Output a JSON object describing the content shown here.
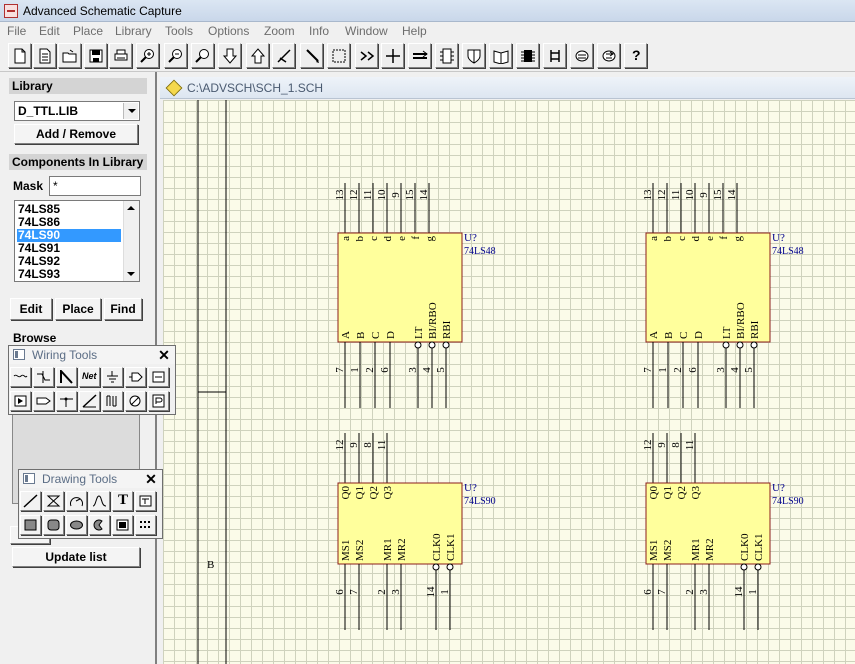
{
  "window": {
    "title": "Advanced Schematic Capture"
  },
  "menu": [
    "File",
    "Edit",
    "Place",
    "Library",
    "Tools",
    "Options",
    "Zoom",
    "Info",
    "Window",
    "Help"
  ],
  "toolbar": {
    "buttons": [
      "new-icon",
      "open-icon",
      "open-folder-icon",
      "save-icon",
      "print-icon",
      "zoom-in-icon",
      "zoom-out-icon",
      "zoom-fit-icon",
      "arrow-down-icon",
      "arrow-up-icon",
      "cut-icon",
      "pencil-icon",
      "select-box-icon",
      "move-icon",
      "cross-icon",
      "bus-icon",
      "component-icon",
      "shield-icon",
      "book-icon",
      "ic-chip-icon",
      "swap-icon",
      "undo-icon",
      "redo-icon",
      "help-icon"
    ],
    "help_label": "?"
  },
  "library": {
    "heading": "Library",
    "selected": "D_TTL.LIB",
    "add_remove_label": "Add / Remove"
  },
  "components": {
    "heading": "Components In Library",
    "mask_label": "Mask",
    "mask_value": "*",
    "items": [
      "74LS85",
      "74LS86",
      "74LS90",
      "74LS91",
      "74LS92",
      "74LS93"
    ],
    "selected": "74LS90"
  },
  "actions": {
    "edit": "Edit",
    "place": "Place",
    "find": "Find"
  },
  "browse": {
    "heading": "Browse",
    "update_label": "Update list"
  },
  "wiring_tools": {
    "title": "Wiring Tools",
    "close": "✕",
    "net_label": "Net",
    "buttons": [
      "wire-icon",
      "bus-entry-icon",
      "bus-icon",
      "net-label-icon",
      "ground-icon",
      "port-icon",
      "sheet-symbol-icon",
      "junction-icon",
      "power-port-icon",
      "no-erc-icon",
      "probe-icon",
      "pin-icon",
      "waveform-icon",
      "no-connect-icon",
      "part-icon"
    ]
  },
  "drawing_tools": {
    "title": "Drawing Tools",
    "close": "✕",
    "text_label": "T",
    "buttons": [
      "line-icon",
      "polygon-icon",
      "arc-icon",
      "bezier-icon",
      "text-icon",
      "text-frame-icon",
      "rectangle-icon",
      "round-rectangle-icon",
      "ellipse-icon",
      "pie-icon",
      "image-icon",
      "array-icon"
    ]
  },
  "document": {
    "title": "C:\\ADVSCH\\SCH_1.SCH",
    "border_label": "B",
    "parts": [
      {
        "designator": "U?",
        "part": "74LS48",
        "top_pins": [
          "13",
          "12",
          "11",
          "10",
          "9",
          "15",
          "14"
        ],
        "top_labels": [
          "a",
          "b",
          "c",
          "d",
          "e",
          "f",
          "g"
        ],
        "bottom_labels": [
          "A",
          "B",
          "C",
          "D",
          "LT",
          "BI/RBO",
          "RBI"
        ],
        "bottom_pins": [
          "7",
          "1",
          "2",
          "6",
          "3",
          "4",
          "5"
        ]
      },
      {
        "designator": "U?",
        "part": "74LS48",
        "top_pins": [
          "13",
          "12",
          "11",
          "10",
          "9",
          "15",
          "14"
        ],
        "top_labels": [
          "a",
          "b",
          "c",
          "d",
          "e",
          "f",
          "g"
        ],
        "bottom_labels": [
          "A",
          "B",
          "C",
          "D",
          "LT",
          "BI/RBO",
          "RBI"
        ],
        "bottom_pins": [
          "7",
          "1",
          "2",
          "6",
          "3",
          "4",
          "5"
        ]
      },
      {
        "designator": "U?",
        "part": "74LS90",
        "top_pins": [
          "12",
          "9",
          "8",
          "11"
        ],
        "top_labels": [
          "Q0",
          "Q1",
          "Q2",
          "Q3"
        ],
        "bottom_labels": [
          "MS1",
          "MS2",
          "MR1",
          "MR2",
          "CLK0",
          "CLK1"
        ],
        "bottom_pins": [
          "6",
          "7",
          "2",
          "3",
          "14",
          "1"
        ]
      },
      {
        "designator": "U?",
        "part": "74LS90",
        "top_pins": [
          "12",
          "9",
          "8",
          "11"
        ],
        "top_labels": [
          "Q0",
          "Q1",
          "Q2",
          "Q3"
        ],
        "bottom_labels": [
          "MS1",
          "MS2",
          "MR1",
          "MR2",
          "CLK0",
          "CLK1"
        ],
        "bottom_pins": [
          "6",
          "7",
          "2",
          "3",
          "14",
          "1"
        ]
      }
    ]
  },
  "colors": {
    "selection": "#3399ff",
    "part_fill": "#ffff9c",
    "part_border": "#8b1c1c",
    "designator": "#00008b",
    "grid": "#cfd2bd",
    "sheet": "#fbfbe9"
  }
}
